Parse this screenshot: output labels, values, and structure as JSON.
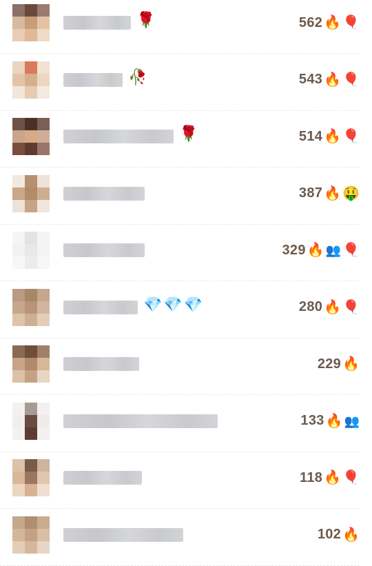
{
  "rows": [
    {
      "score": "562",
      "name_width": 98,
      "deco": "rose",
      "badges": [
        "fire-icon",
        "balloon-icon"
      ],
      "avatar": [
        "#8c6f66",
        "#6b4a3d",
        "#9a7b70",
        "#d8b89e",
        "#c89d7a",
        "#e2c3a6",
        "#e8cdb4",
        "#e0b996",
        "#efdcc8"
      ]
    },
    {
      "score": "543",
      "name_width": 86,
      "deco": "rose-wilt",
      "badges": [
        "fire-icon",
        "balloon-icon"
      ],
      "avatar": [
        "#e9d4bf",
        "#d97b5a",
        "#f0e2d2",
        "#e3c4a7",
        "#d6b08e",
        "#ecd7c2",
        "#f1e6da",
        "#e6cbb0",
        "#f3ebe1"
      ]
    },
    {
      "score": "514",
      "name_width": 160,
      "deco": "rose",
      "badges": [
        "fire-icon",
        "balloon-icon"
      ],
      "avatar": [
        "#6e5247",
        "#4a3128",
        "#7b5f54",
        "#c8a58c",
        "#d9a985",
        "#cfae98",
        "#7a4e3f",
        "#5e3b2e",
        "#9a7468"
      ]
    },
    {
      "score": "387",
      "name_width": 118,
      "deco": "",
      "badges": [
        "fire-icon",
        "face-icon"
      ],
      "avatar": [
        "#f1e9df",
        "#b8906f",
        "#eee3d7",
        "#c9a788",
        "#b48b69",
        "#cfae90",
        "#eee2d6",
        "#c8a486",
        "#f0e6dc"
      ]
    },
    {
      "score": "329",
      "name_width": 118,
      "deco": "",
      "badges": [
        "fire-icon",
        "couple-icon",
        "balloon-icon"
      ],
      "avatar": [
        "#f5f5f5",
        "#e3e3e3",
        "#f4f4f4",
        "#f2f2f2",
        "#e8e8e8",
        "#f3f3f3",
        "#f7f7f7",
        "#ececec",
        "#f6f6f6"
      ]
    },
    {
      "score": "280",
      "name_width": 108,
      "deco": "diamonds",
      "badges": [
        "fire-icon",
        "balloon-icon"
      ],
      "avatar": [
        "#b89b82",
        "#a88668",
        "#c4a78e",
        "#c7a68a",
        "#b8957a",
        "#d2b59c",
        "#dcc4ad",
        "#cfae92",
        "#e3cdb8"
      ]
    },
    {
      "score": "229",
      "name_width": 110,
      "deco": "",
      "badges": [
        "fire-icon"
      ],
      "avatar": [
        "#8a6a55",
        "#6f4f3b",
        "#a08068",
        "#c9a488",
        "#b08a6b",
        "#d6b799",
        "#dcc1a6",
        "#c6a285",
        "#e8d6c3"
      ]
    },
    {
      "score": "133",
      "name_width": 224,
      "deco": "",
      "badges": [
        "fire-icon",
        "couple-icon"
      ],
      "avatar": [
        "#f4f2f1",
        "#a89a95",
        "#f3f1f0",
        "#f1eeec",
        "#6b4a42",
        "#efebea",
        "#f4f1f0",
        "#5e3c34",
        "#f3f0ee"
      ]
    },
    {
      "score": "118",
      "name_width": 114,
      "deco": "",
      "badges": [
        "fire-icon",
        "balloon-icon"
      ],
      "avatar": [
        "#dcc2ab",
        "#7a5a49",
        "#cfb39b",
        "#d9b898",
        "#9b7661",
        "#e1c6ab",
        "#ecd6c0",
        "#d7b393",
        "#efdfcf"
      ]
    },
    {
      "score": "102",
      "name_width": 174,
      "deco": "",
      "badges": [
        "fire-icon"
      ],
      "avatar": [
        "#c5a78b",
        "#b08e6f",
        "#c9ac90",
        "#d4b699",
        "#c4a385",
        "#d8bea3",
        "#e4cdb6",
        "#d5b89c",
        "#e8d6c4"
      ]
    }
  ]
}
